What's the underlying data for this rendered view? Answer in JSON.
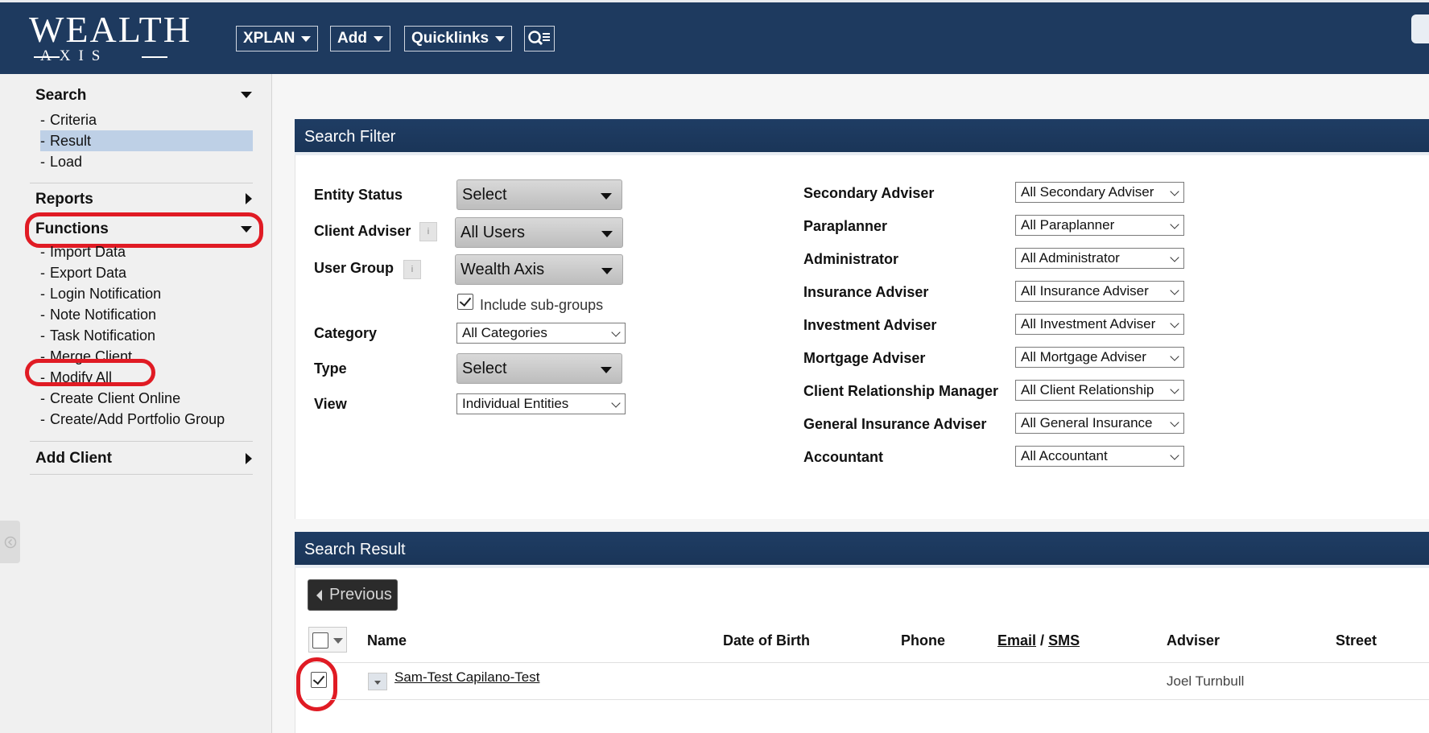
{
  "logo": {
    "main": "WEALTH",
    "sub": "AXIS"
  },
  "topnav": [
    {
      "label": "XPLAN"
    },
    {
      "label": "Add"
    },
    {
      "label": "Quicklinks"
    }
  ],
  "sidebar": {
    "search": {
      "title": "Search",
      "items": [
        "Criteria",
        "Result",
        "Load"
      ],
      "active": "Result"
    },
    "reports": {
      "title": "Reports"
    },
    "functions": {
      "title": "Functions",
      "items": [
        "Import Data",
        "Export Data",
        "Login Notification",
        "Note Notification",
        "Task Notification",
        "Merge Client",
        "Modify All",
        "Create Client Online",
        "Create/Add Portfolio Group"
      ]
    },
    "add_client": {
      "title": "Add Client"
    }
  },
  "search_filter": {
    "title": "Search Filter",
    "left": {
      "entity_status": {
        "label": "Entity Status",
        "value": "Select"
      },
      "client_adviser": {
        "label": "Client Adviser",
        "value": "All Users"
      },
      "user_group": {
        "label": "User Group",
        "value": "Wealth Axis"
      },
      "include_subgroups": {
        "label": "Include sub-groups",
        "checked": true
      },
      "category": {
        "label": "Category",
        "value": "All Categories"
      },
      "type": {
        "label": "Type",
        "value": "Select"
      },
      "view": {
        "label": "View",
        "value": "Individual Entities"
      }
    },
    "right": [
      {
        "label": "Secondary Adviser",
        "value": "All Secondary Adviser"
      },
      {
        "label": "Paraplanner",
        "value": "All Paraplanner"
      },
      {
        "label": "Administrator",
        "value": "All Administrator"
      },
      {
        "label": "Insurance Adviser",
        "value": "All Insurance Adviser"
      },
      {
        "label": "Investment Adviser",
        "value": "All Investment Adviser"
      },
      {
        "label": "Mortgage Adviser",
        "value": "All Mortgage Adviser"
      },
      {
        "label": "Client Relationship Manager",
        "value": "All Client Relationship"
      },
      {
        "label": "General Insurance Adviser",
        "value": "All General Insurance"
      },
      {
        "label": "Accountant",
        "value": "All Accountant"
      }
    ],
    "info_glyph": "i"
  },
  "search_result": {
    "title": "Search Result",
    "previous_label": "Previous",
    "columns": {
      "name": "Name",
      "dob": "Date of Birth",
      "phone": "Phone",
      "email": "Email",
      "sep": "/",
      "sms": "SMS",
      "adviser": "Adviser",
      "street": "Street"
    },
    "rows": [
      {
        "name": "Sam-Test Capilano-Test",
        "dob": "",
        "phone": "",
        "email": "",
        "adviser": "Joel Turnbull",
        "street": "",
        "checked": true
      }
    ]
  },
  "colors": {
    "header_bg": "#1e3a5f",
    "highlight": "#e01b24",
    "active_item": "#bed0e6"
  }
}
